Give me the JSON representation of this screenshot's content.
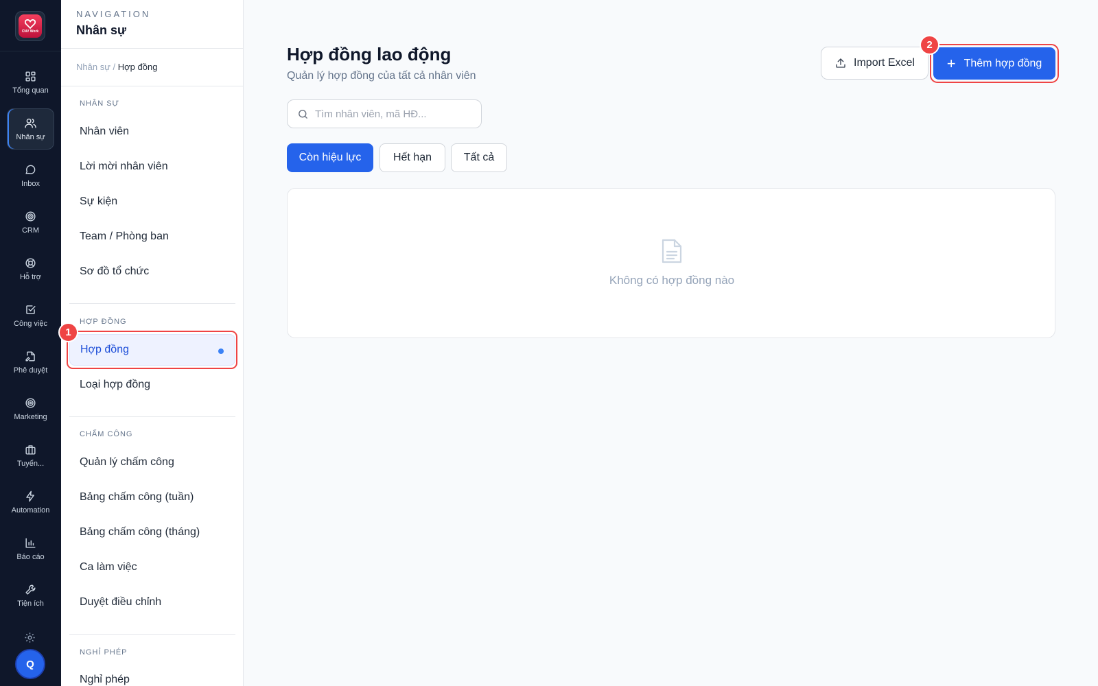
{
  "app": {
    "logo_text": "CNV Work",
    "avatar_letter": "Q",
    "accent_color": "#2563eb",
    "highlight_color": "#ef4444"
  },
  "rail": {
    "items": [
      {
        "label": "Tổng quan",
        "icon": "dashboard-icon"
      },
      {
        "label": "Nhân sự",
        "icon": "users-icon",
        "active": true
      },
      {
        "label": "Inbox",
        "icon": "chat-bubble-icon"
      },
      {
        "label": "CRM",
        "icon": "target-icon"
      },
      {
        "label": "Hỗ trợ",
        "icon": "lifebuoy-icon"
      },
      {
        "label": "Công việc",
        "icon": "check-square-icon"
      },
      {
        "label": "Phê duyệt",
        "icon": "file-sign-icon"
      },
      {
        "label": "Marketing",
        "icon": "target-icon"
      },
      {
        "label": "Tuyển...",
        "icon": "briefcase-icon"
      },
      {
        "label": "Automation",
        "icon": "lightning-icon"
      },
      {
        "label": "Báo cáo",
        "icon": "bar-chart-icon"
      },
      {
        "label": "Tiện ích",
        "icon": "wrench-icon"
      }
    ]
  },
  "subnav": {
    "header_small": "NAVIGATION",
    "header_title": "Nhân sự",
    "breadcrumb_parent": "Nhân sự /",
    "breadcrumb_current": "Hợp đồng",
    "sections": [
      {
        "title": "NHÂN SỰ",
        "items": [
          "Nhân viên",
          "Lời mời nhân viên",
          "Sự kiện",
          "Team / Phòng ban",
          "Sơ đồ tổ chức"
        ]
      },
      {
        "title": "HỢP ĐỒNG",
        "items": [
          "Hợp đồng",
          "Loại hợp đồng"
        ]
      },
      {
        "title": "CHẤM CÔNG",
        "items": [
          "Quản lý chấm công",
          "Bảng chấm công (tuần)",
          "Bảng chấm công (tháng)",
          "Ca làm việc",
          "Duyệt điều chỉnh"
        ]
      },
      {
        "title": "NGHỈ PHÉP",
        "items": [
          "Nghỉ phép"
        ]
      }
    ],
    "active_item": "Hợp đồng"
  },
  "main": {
    "title": "Hợp đồng lao động",
    "subtitle": "Quản lý hợp đồng của tất cả nhân viên",
    "import_label": "Import Excel",
    "add_label": "Thêm hợp đồng",
    "search_placeholder": "Tìm nhân viên, mã HĐ...",
    "filters": [
      {
        "label": "Còn hiệu lực",
        "active": true
      },
      {
        "label": "Hết hạn",
        "active": false
      },
      {
        "label": "Tất cả",
        "active": false
      }
    ],
    "empty_text": "Không có hợp đồng nào"
  },
  "annotations": [
    {
      "number": "1",
      "target": "Hợp đồng"
    },
    {
      "number": "2",
      "target": "Thêm hợp đồng"
    }
  ]
}
